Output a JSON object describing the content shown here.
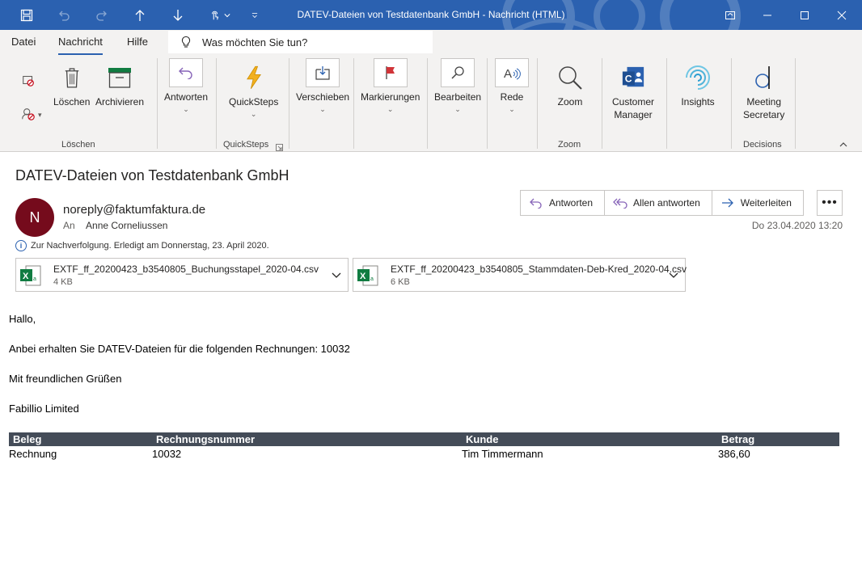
{
  "window": {
    "title": "DATEV-Dateien von Testdatenbank GmbH  -  Nachricht (HTML)"
  },
  "ribbon_tabs": [
    {
      "label": "Datei"
    },
    {
      "label": "Nachricht"
    },
    {
      "label": "Hilfe"
    }
  ],
  "tellme": {
    "placeholder": "Was möchten Sie tun?"
  },
  "ribbon": {
    "loeschen": "Löschen",
    "archivieren": "Archivieren",
    "antworten": "Antworten",
    "quicksteps": "QuickSteps",
    "verschieben": "Verschieben",
    "markierungen": "Markierungen",
    "bearbeiten": "Bearbeiten",
    "rede": "Rede",
    "zoom": "Zoom",
    "customer_manager_1": "Customer",
    "customer_manager_2": "Manager",
    "insights": "Insights",
    "meeting_secretary_1": "Meeting",
    "meeting_secretary_2": "Secretary",
    "groups": {
      "loeschen": "Löschen",
      "quicksteps": "QuickSteps",
      "zoom": "Zoom",
      "decisions": "Decisions"
    }
  },
  "message": {
    "subject": "DATEV-Dateien von Testdatenbank GmbH",
    "avatar_initial": "N",
    "sender": "noreply@faktumfaktura.de",
    "to_label": "An",
    "to_name": "Anne Corneliussen",
    "followup": "Zur Nachverfolgung.  Erledigt am Donnerstag, 23. April 2020.",
    "date": "Do 23.04.2020 13:20",
    "actions": {
      "reply": "Antworten",
      "reply_all": "Allen antworten",
      "forward": "Weiterleiten"
    },
    "attachments": [
      {
        "name": "EXTF_ff_20200423_b3540805_Buchungsstapel_2020-04.csv",
        "size": "4 KB"
      },
      {
        "name": "EXTF_ff_20200423_b3540805_Stammdaten-Deb-Kred_2020-04.csv",
        "size": "6 KB"
      }
    ],
    "body": {
      "greeting": "Hallo,",
      "line1": "Anbei erhalten Sie DATEV-Dateien für die folgenden Rechnungen: 10032",
      "closing": "Mit freundlichen Grüßen",
      "signature": "Fabillio Limited"
    },
    "table": {
      "headers": [
        "Beleg",
        "Rechnungsnummer",
        "Kunde",
        "Betrag"
      ],
      "rows": [
        [
          "Rechnung",
          "10032",
          "Tim Timmermann",
          "386,60"
        ]
      ]
    }
  },
  "colors": {
    "titlebar": "#2b61b0",
    "ribbon": "#f3f2f1",
    "avatar": "#750b1c",
    "table_header": "#444c58"
  },
  "icons": [
    "save-icon",
    "undo-icon",
    "redo-icon",
    "up-arrow-icon",
    "down-arrow-icon",
    "touch-mode-icon",
    "customize-qat-icon",
    "ribbon-display-icon",
    "minimize-icon",
    "maximize-icon",
    "close-icon"
  ]
}
